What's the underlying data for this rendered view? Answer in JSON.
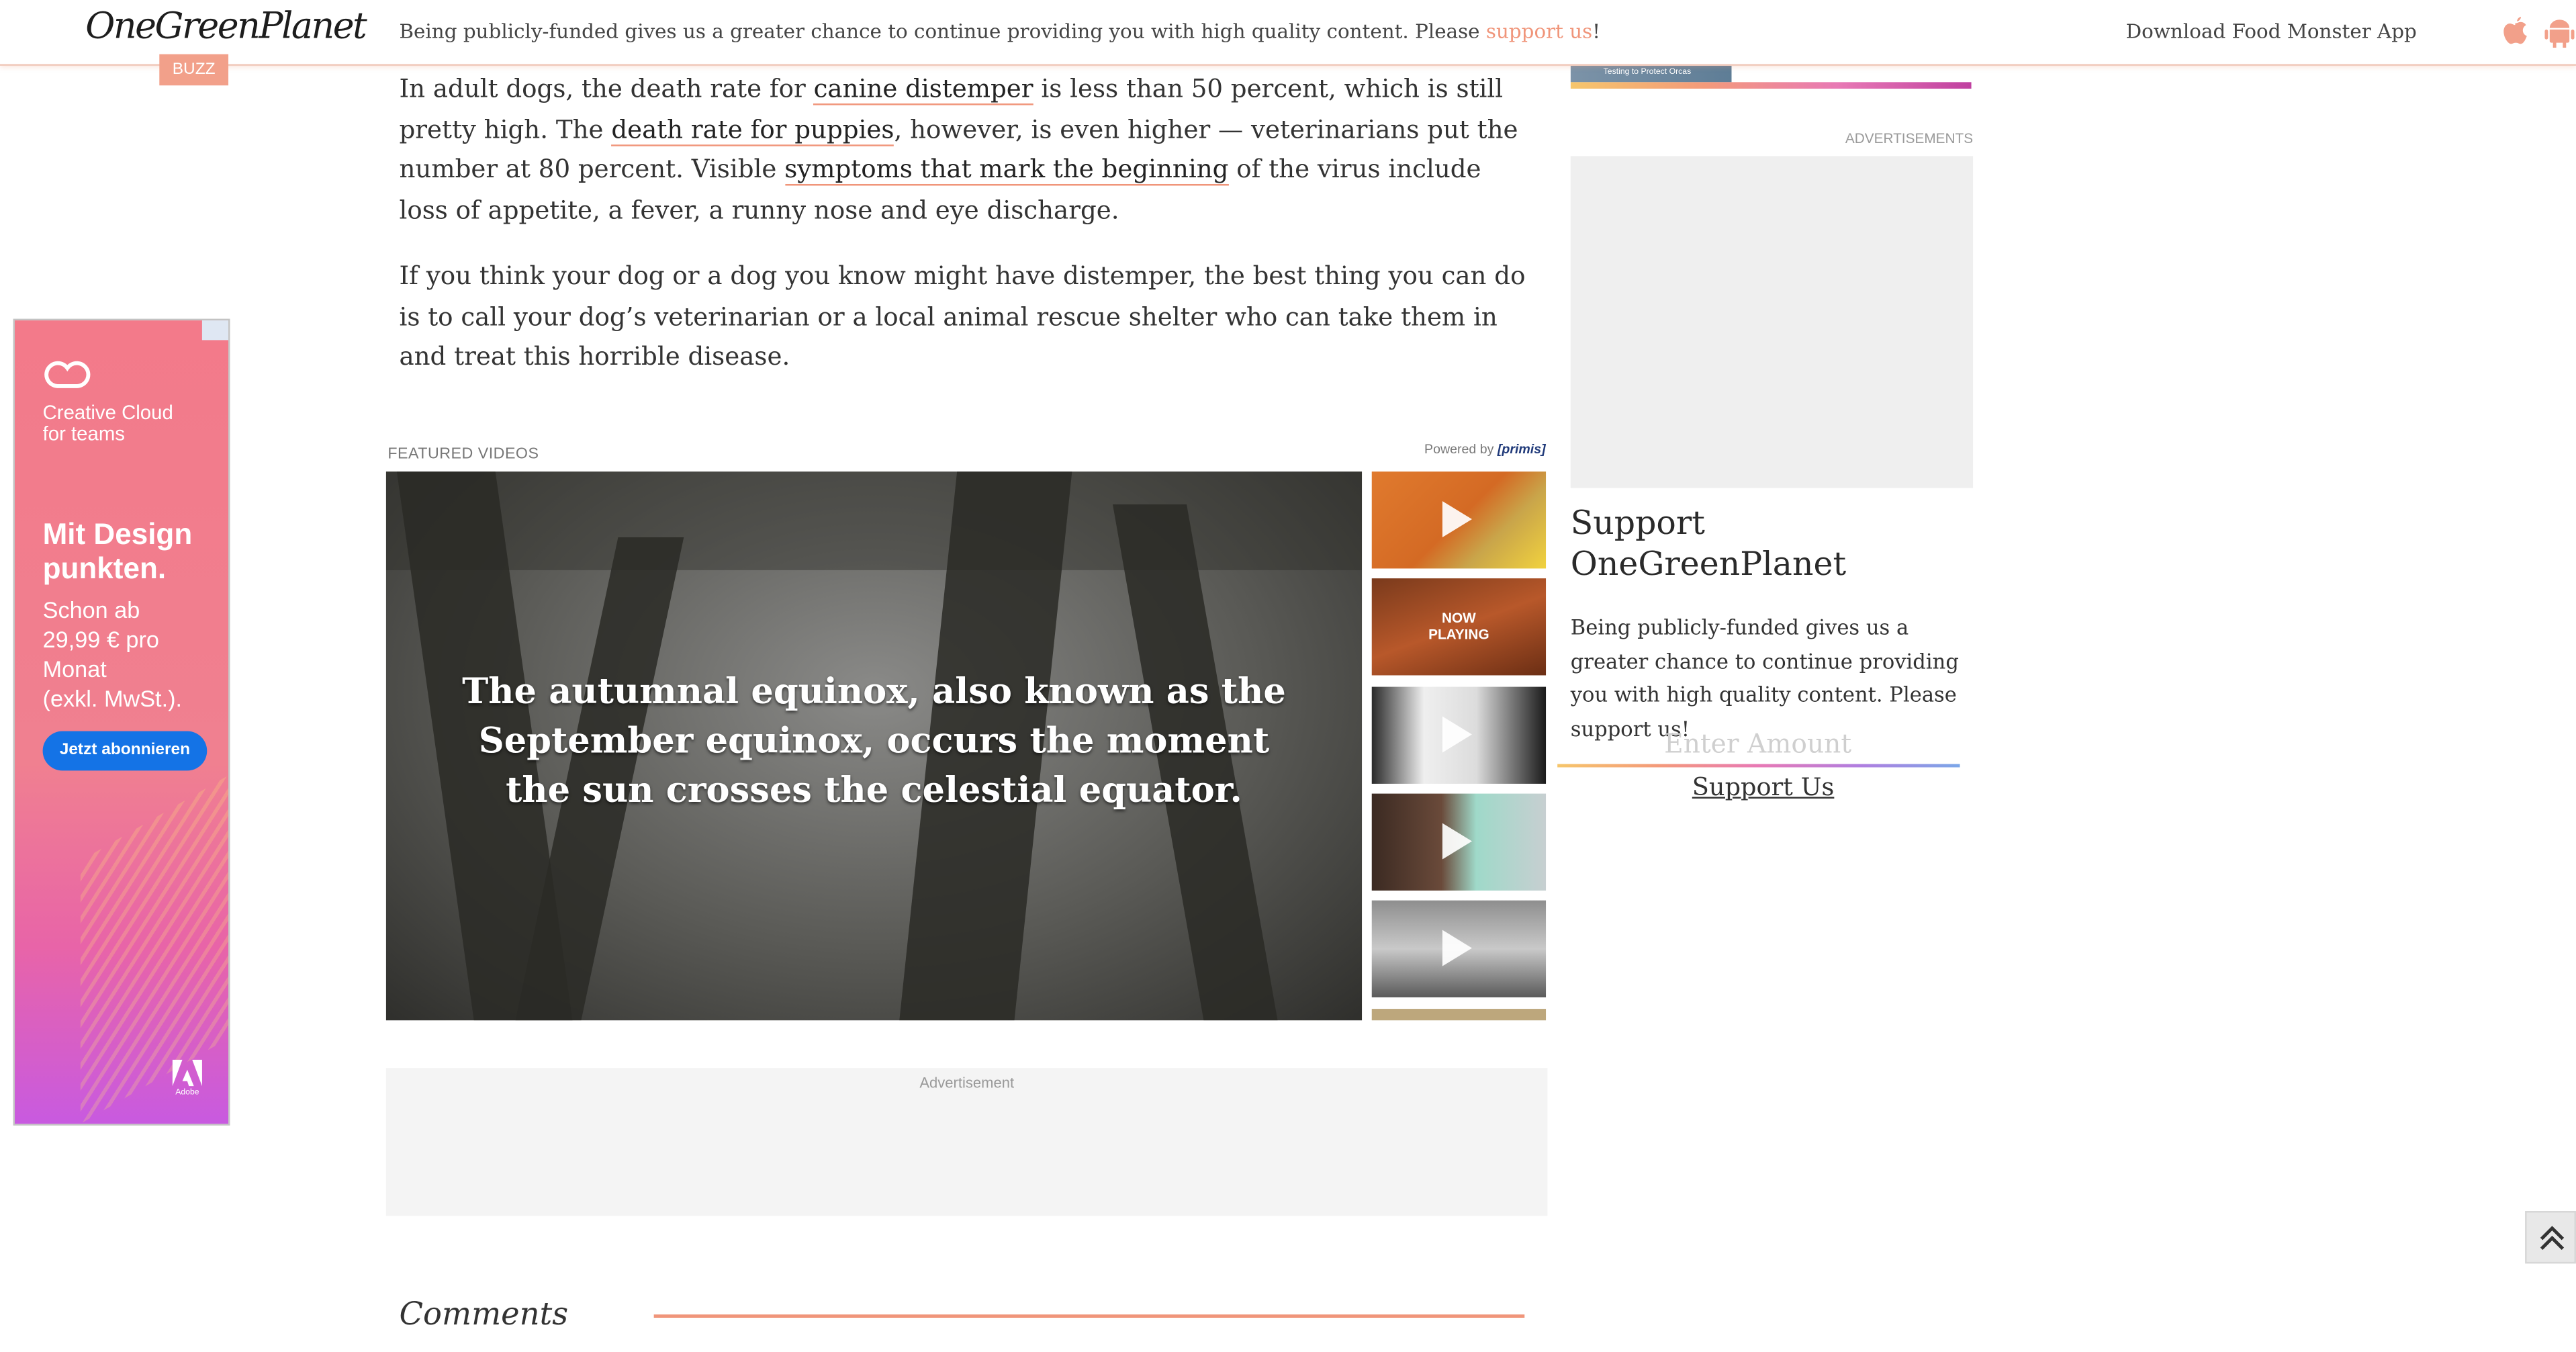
{
  "header": {
    "logo": "OneGreenPlanet",
    "section_badge": "BUZZ",
    "notice_prefix": "Being publicly-funded gives us a greater chance to continue providing you with high quality content. Please ",
    "notice_link": "support us",
    "notice_suffix": "!",
    "download_app": "Download Food Monster App",
    "icons": [
      "apple-icon",
      "android-icon"
    ],
    "accent_color": "#f0957a"
  },
  "article": {
    "p1": {
      "t1": "In adult dogs, the death rate for ",
      "l1": "canine distemper",
      "t2": " is less than 50 percent, which is still pretty high. The ",
      "l2": "death rate for puppies",
      "t3": ", however, is even higher — veterinarians put the number at 80 percent. Visible ",
      "l3": "symptoms that mark the beginning",
      "t4": " of the virus include loss of appetite, a fever, a runny nose and eye discharge."
    },
    "p2": "If you think your dog or a dog you know might have distemper, the best thing you can do is to call your dog’s veterinarian or a local animal rescue shelter who can take them in and treat this horrible disease."
  },
  "left_ad": {
    "brand": "Creative Cloud\nfor teams",
    "headline": "Mit Design\npunkten.",
    "price": "Schon ab\n29,99 € pro\nMonat\n(exkl. MwSt.).",
    "cta": "Jetzt abonnieren",
    "footer_logo": "Adobe"
  },
  "videos": {
    "label": "FEATURED VIDEOS",
    "powered_by": "Powered by",
    "provider": "[primis]",
    "caption": "The autumnal equinox, also known as the September equinox, occurs the moment the sun crosses the celestial equator.",
    "now_playing": "NOW\nPLAYING"
  },
  "ad_slot": {
    "label": "Advertisement"
  },
  "comments": {
    "title": "Comments"
  },
  "sidebar": {
    "ads_label": "ADVERTISEMENTS",
    "support_title": "Support OneGreenPlanet",
    "support_text": "Being publicly-funded gives us a greater chance to continue providing you with high quality content. Please support us!",
    "amount_placeholder": "Enter Amount",
    "support_button": "Support Us",
    "top_image_caption": "Testing to Protect Orcas"
  }
}
